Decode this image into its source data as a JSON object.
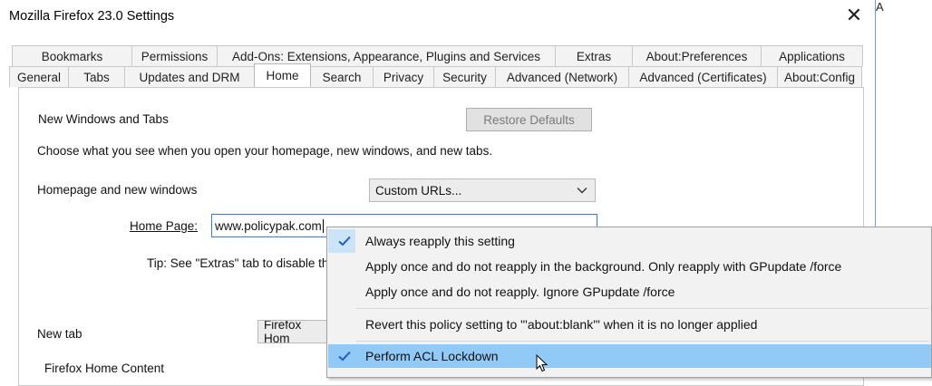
{
  "window": {
    "title": "Mozilla Firefox 23.0 Settings",
    "close_glyph": "✕"
  },
  "right_stub": "A",
  "tabs": {
    "row1": [
      "Bookmarks",
      "Permissions",
      "Add-Ons: Extensions, Appearance, Plugins and Services",
      "Extras",
      "About:Preferences",
      "Applications"
    ],
    "row2": [
      "General",
      "Tabs",
      "Updates and DRM",
      "Home",
      "Search",
      "Privacy",
      "Security",
      "Advanced (Network)",
      "Advanced (Certificates)",
      "About:Config"
    ],
    "active": "Home"
  },
  "home": {
    "section_title": "New Windows and Tabs",
    "restore_defaults": "Restore Defaults",
    "description": "Choose what you see when you open your homepage, new windows, and new tabs.",
    "homepage_label": "Homepage and new windows",
    "homepage_select": "Custom URLs...",
    "home_page_label": "Home Page:",
    "home_page_value": "www.policypak.com",
    "tip": "Tip: See \"Extras\" tab to disable th",
    "new_tab_label": "New tab",
    "new_tab_select": "Firefox Hom",
    "home_content_label": "Firefox Home Content"
  },
  "context_menu": {
    "items": [
      {
        "label": "Always reapply this setting",
        "checked": true
      },
      {
        "label": "Apply once and do not reapply in the background. Only reapply with GPupdate /force",
        "checked": false
      },
      {
        "label": "Apply once and do not reapply. Ignore GPupdate /force",
        "checked": false
      },
      {
        "label": "Revert this policy setting to \"'about:blank'\" when it is no longer applied",
        "checked": false
      },
      {
        "label": "Perform ACL Lockdown",
        "checked": true,
        "hover": true
      }
    ]
  },
  "colors": {
    "accent": "#3d7bd9",
    "menu_hover": "#91c9f7",
    "check_bg": "#cce4f7"
  }
}
